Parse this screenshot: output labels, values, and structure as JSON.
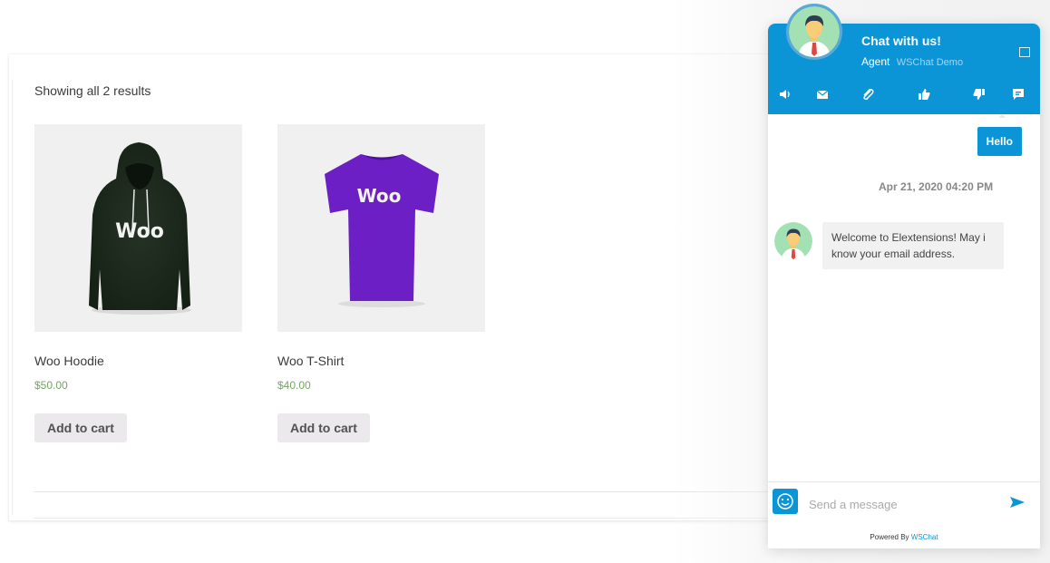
{
  "shop": {
    "results_text": "Showing all 2 results",
    "products": [
      {
        "name": "Woo Hoodie",
        "price": "$50.00",
        "button": "Add to cart",
        "logo_text": "Woo"
      },
      {
        "name": "Woo T-Shirt",
        "price": "$40.00",
        "button": "Add to cart",
        "logo_text": "Woo"
      }
    ]
  },
  "chat": {
    "title": "Chat with us!",
    "agent_label": "Agent",
    "agent_name": "WSChat Demo",
    "toolbar_icons": [
      "speaker-icon",
      "email-icon",
      "attachment-icon",
      "thumbs-up-icon",
      "thumbs-down-icon",
      "feedback-icon"
    ],
    "messages": {
      "user": "Hello",
      "timestamp": "Apr 21, 2020 04:20 PM",
      "agent": "Welcome to Elextensions! May i know your email address."
    },
    "input_placeholder": "Send a message",
    "powered_prefix": "Powered By",
    "powered_brand": "WSChat",
    "colors": {
      "accent": "#0b95d6",
      "price": "#77a464"
    }
  }
}
